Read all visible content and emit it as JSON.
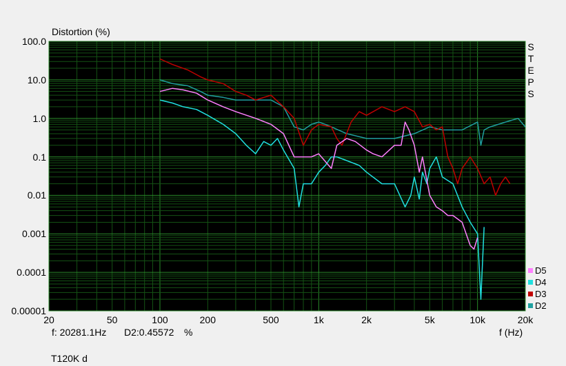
{
  "chart_data": {
    "type": "line",
    "ylabel": "Distortion (%)",
    "xlabel": "f (Hz)",
    "x_scale": "log",
    "y_scale": "log",
    "xlim": [
      20,
      20000
    ],
    "ylim": [
      1e-05,
      100
    ],
    "x_ticks": [
      20,
      50,
      100,
      200,
      500,
      1000,
      2000,
      5000,
      10000,
      20000
    ],
    "x_tick_labels": [
      "20",
      "50",
      "100",
      "200",
      "500",
      "1k",
      "2k",
      "5k",
      "10k",
      "20k"
    ],
    "y_ticks": [
      1e-05,
      0.0001,
      0.001,
      0.01,
      0.1,
      1,
      10,
      100
    ],
    "y_tick_labels": [
      "0.00001",
      "0.0001",
      "0.001",
      "0.01",
      "0.1",
      "1.0",
      "10.0",
      "100.0"
    ],
    "grid": true,
    "legend_position": "bottom-right",
    "side_label": "STEPS",
    "readout_freq": "f: 20281.1Hz",
    "readout_value": "D2:0.45572",
    "readout_unit": "%",
    "caption": "T120K d",
    "series": [
      {
        "name": "D5",
        "color": "#ff80ff",
        "x": [
          100,
          120,
          140,
          170,
          200,
          250,
          300,
          400,
          500,
          600,
          700,
          800,
          900,
          1000,
          1200,
          1300,
          1500,
          1700,
          2000,
          2200,
          2500,
          3000,
          3300,
          3500,
          3700,
          4000,
          4300,
          4500,
          5000,
          5500,
          6000,
          6500,
          7000,
          8000,
          9000,
          9500,
          10000
        ],
        "y": [
          5,
          6,
          5.5,
          4.5,
          3,
          2,
          1.5,
          1,
          0.7,
          0.4,
          0.1,
          0.1,
          0.1,
          0.12,
          0.05,
          0.2,
          0.3,
          0.25,
          0.15,
          0.12,
          0.1,
          0.2,
          0.2,
          0.8,
          0.5,
          0.2,
          0.04,
          0.1,
          0.01,
          0.005,
          0.004,
          0.003,
          0.003,
          0.002,
          0.0005,
          0.0004,
          0.0008
        ]
      },
      {
        "name": "D4",
        "color": "#20e0e0",
        "x": [
          100,
          120,
          140,
          170,
          200,
          250,
          300,
          350,
          400,
          450,
          500,
          550,
          600,
          700,
          750,
          800,
          900,
          1000,
          1100,
          1200,
          1300,
          1500,
          1800,
          2000,
          2500,
          3000,
          3500,
          3800,
          4000,
          4300,
          4500,
          4800,
          5000,
          5500,
          6000,
          7000,
          8000,
          9000,
          10000,
          10500,
          11000
        ],
        "y": [
          3,
          2.5,
          2,
          1.7,
          1.2,
          0.7,
          0.4,
          0.2,
          0.12,
          0.25,
          0.2,
          0.3,
          0.15,
          0.05,
          0.005,
          0.02,
          0.02,
          0.04,
          0.06,
          0.1,
          0.1,
          0.08,
          0.06,
          0.04,
          0.02,
          0.02,
          0.005,
          0.01,
          0.03,
          0.008,
          0.04,
          0.02,
          0.05,
          0.1,
          0.03,
          0.02,
          0.005,
          0.002,
          0.001,
          2e-05,
          0.0015
        ]
      },
      {
        "name": "D3",
        "color": "#c00000",
        "x": [
          100,
          120,
          150,
          180,
          200,
          250,
          300,
          350,
          400,
          500,
          600,
          700,
          800,
          900,
          1000,
          1200,
          1300,
          1400,
          1600,
          1800,
          2000,
          2500,
          3000,
          3500,
          4000,
          4500,
          5000,
          5500,
          6000,
          6500,
          7000,
          7500,
          8000,
          9000,
          10000,
          11000,
          12000,
          13000,
          14000,
          15000,
          16000
        ],
        "y": [
          35,
          25,
          18,
          12,
          10,
          8,
          5,
          4,
          3,
          4,
          2,
          1,
          0.2,
          0.5,
          0.7,
          0.6,
          0.3,
          0.2,
          0.8,
          1.5,
          1.2,
          2,
          1.5,
          2,
          1.5,
          0.6,
          0.7,
          0.5,
          0.6,
          0.1,
          0.05,
          0.02,
          0.05,
          0.1,
          0.05,
          0.02,
          0.03,
          0.01,
          0.02,
          0.03,
          0.02
        ]
      },
      {
        "name": "D2",
        "color": "#20a0a0",
        "x": [
          100,
          120,
          150,
          180,
          200,
          250,
          300,
          400,
          500,
          600,
          700,
          800,
          900,
          1000,
          1100,
          1200,
          1500,
          2000,
          2500,
          3000,
          4000,
          5000,
          6000,
          7000,
          8000,
          10000,
          10500,
          11000,
          12000,
          15000,
          18000,
          20000
        ],
        "y": [
          10,
          8,
          7,
          5,
          4,
          3.5,
          3,
          3,
          3,
          2,
          0.6,
          0.5,
          0.7,
          0.8,
          0.7,
          0.6,
          0.4,
          0.3,
          0.3,
          0.3,
          0.4,
          0.6,
          0.5,
          0.5,
          0.5,
          0.8,
          0.2,
          0.5,
          0.6,
          0.8,
          1,
          0.6
        ]
      }
    ]
  }
}
